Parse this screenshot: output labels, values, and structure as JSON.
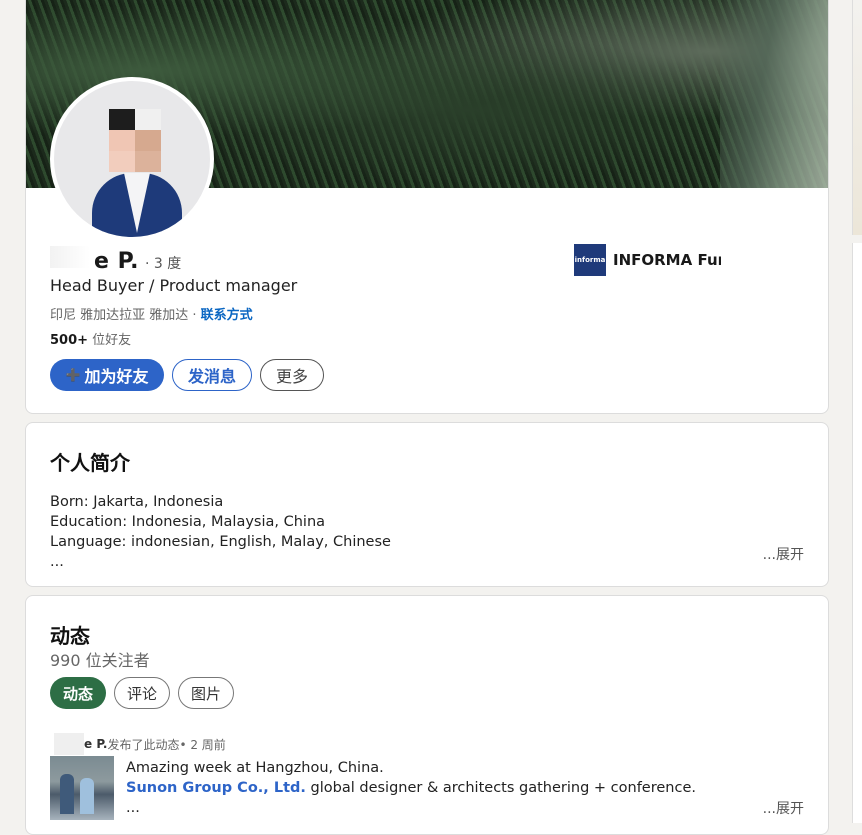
{
  "profile": {
    "name": "e P.",
    "degree": "· 3 度",
    "headline": "Head Buyer / Product manager",
    "location": "印尼 雅加达拉亚 雅加达 · ",
    "contact_label": "联系方式",
    "connections_count": "500+",
    "connections_label": " 位好友",
    "company_logo_text": "informa",
    "company_name": "INFORMA Furn"
  },
  "actions": {
    "add_friend_icon": "person-add-icon",
    "add_friend": "加为好友",
    "message": "发消息",
    "more": "更多"
  },
  "about": {
    "title": "个人简介",
    "lines": [
      "Born: Jakarta, Indonesia",
      "Education: Indonesia, Malaysia, China",
      "Language: indonesian, English, Malay, Chinese",
      "..."
    ],
    "expand": "...展开"
  },
  "activity": {
    "title": "动态",
    "followers": "990 位关注者",
    "tabs": [
      "动态",
      "评论",
      "图片"
    ],
    "post": {
      "author": "e P.",
      "meta": "发布了此动态• 2 周前",
      "line1": "Amazing week at Hangzhou, China.",
      "link": "Sunon Group Co., Ltd.",
      "line2_rest": " global designer & architects gathering + conference.",
      "ellipsis": "...",
      "expand": "...展开"
    }
  },
  "colors": {
    "primary": "#2d64c8",
    "active_tab": "#2d6e45",
    "link": "#0a66c2"
  }
}
